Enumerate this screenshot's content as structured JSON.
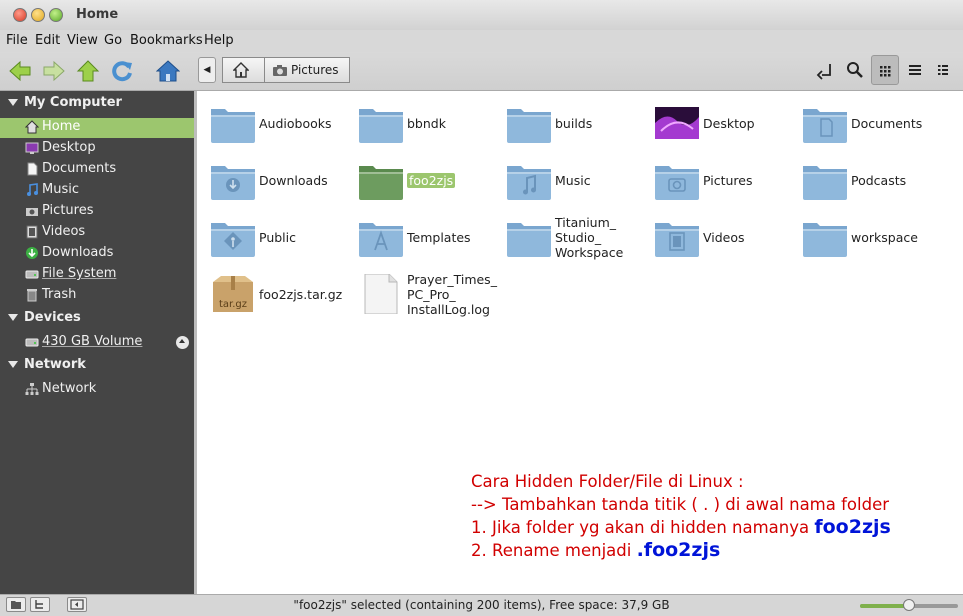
{
  "window": {
    "title": "Home"
  },
  "menu": [
    "File",
    "Edit",
    "View",
    "Go",
    "Bookmarks",
    "Help"
  ],
  "breadcrumb": {
    "current": "Pictures"
  },
  "sidebar": {
    "sections": [
      {
        "title": "My Computer",
        "items": [
          "Home",
          "Desktop",
          "Documents",
          "Music",
          "Pictures",
          "Videos",
          "Downloads",
          "File System",
          "Trash"
        ],
        "selected": "Home"
      },
      {
        "title": "Devices",
        "items": [
          "430 GB Volume"
        ]
      },
      {
        "title": "Network",
        "items": [
          "Network"
        ]
      }
    ]
  },
  "files": [
    {
      "name": "Audiobooks",
      "icon": "folder-icon"
    },
    {
      "name": "bbndk",
      "icon": "folder-icon"
    },
    {
      "name": "builds",
      "icon": "folder-icon"
    },
    {
      "name": "Desktop",
      "icon": "desktop-folder-icon"
    },
    {
      "name": "Documents",
      "icon": "documents-folder-icon"
    },
    {
      "name": "Downloads",
      "icon": "downloads-folder-icon"
    },
    {
      "name": "foo2zjs",
      "icon": "folder-icon",
      "selected": true
    },
    {
      "name": "Music",
      "icon": "music-folder-icon"
    },
    {
      "name": "Pictures",
      "icon": "pictures-folder-icon"
    },
    {
      "name": "Podcasts",
      "icon": "folder-icon"
    },
    {
      "name": "Public",
      "icon": "public-folder-icon"
    },
    {
      "name": "Templates",
      "icon": "templates-folder-icon"
    },
    {
      "name": "Titanium_\nStudio_\nWorkspace",
      "icon": "folder-icon"
    },
    {
      "name": "Videos",
      "icon": "videos-folder-icon"
    },
    {
      "name": "workspace",
      "icon": "folder-icon"
    },
    {
      "name": "foo2zjs.tar.gz",
      "icon": "archive-icon",
      "badge": "tar.gz"
    },
    {
      "name": "Prayer_Times_\nPC_Pro_\nInstallLog.log",
      "icon": "text-file-icon"
    }
  ],
  "annotation": {
    "line1": "Cara Hidden Folder/File di Linux :",
    "line2": "--> Tambahkan tanda titik ( . ) di awal nama folder",
    "line3_text": "1. Jika folder yg akan di hidden namanya ",
    "line3_name": "foo2zjs",
    "line4_text": "2. Rename menjadi ",
    "line4_name": ".foo2zjs"
  },
  "status": {
    "text": "\"foo2zjs\" selected (containing 200 items), Free space: 37,9 GB",
    "zoom_level": 0.5
  },
  "colors": {
    "accent": "#9cc66e",
    "sidebar_bg": "#454545",
    "annotation_red": "#d10000",
    "annotation_blue": "#0014d8"
  }
}
